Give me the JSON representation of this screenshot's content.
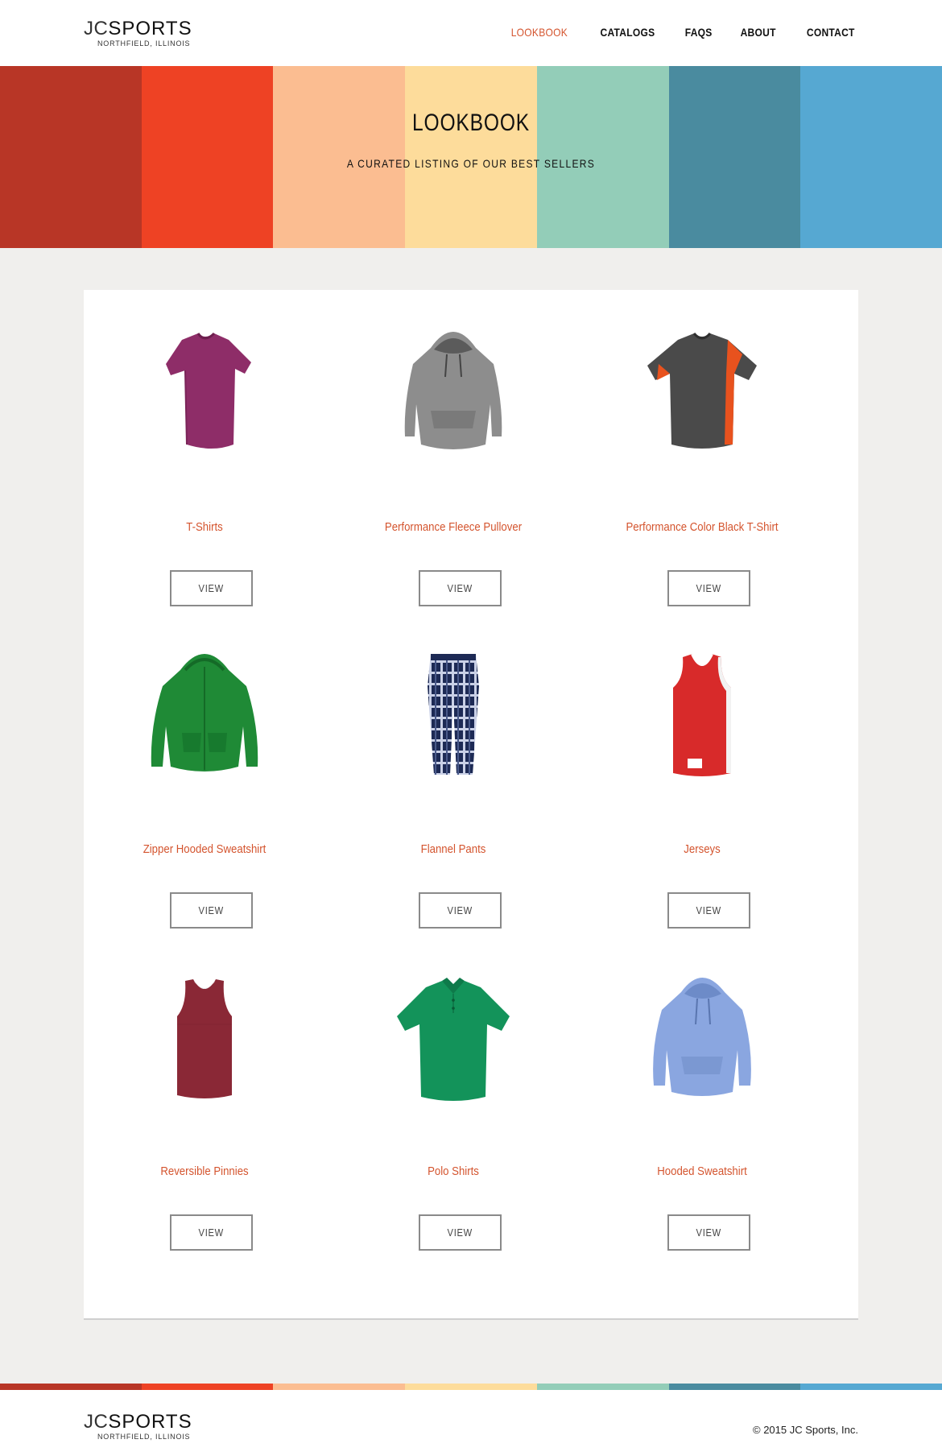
{
  "brand": {
    "name_jc": "JC",
    "name_sports": "SPORTS",
    "tagline": "NORTHFIELD, ILLINOIS",
    "accent": "#d4542e"
  },
  "nav": {
    "items": [
      "LOOKBOOK",
      "CATALOGS",
      "FAQS",
      "ABOUT",
      "CONTACT"
    ],
    "active": "LOOKBOOK"
  },
  "hero": {
    "title": "LOOKBOOK",
    "subtitle": "A CURATED LISTING OF OUR BEST SELLERS",
    "stripe_colors": [
      "#b83626",
      "#ee4224",
      "#fbbd91",
      "#fddc9b",
      "#93cdb8",
      "#4a8b9f",
      "#56a8d2"
    ]
  },
  "products": [
    {
      "name": "T-Shirts",
      "button": "VIEW",
      "icon": "tshirt-magenta-icon"
    },
    {
      "name": "Performance Fleece Pullover",
      "button": "VIEW",
      "icon": "grey-hoodie-icon"
    },
    {
      "name": "Performance Color Black T-Shirt",
      "button": "VIEW",
      "icon": "performance-tee-icon"
    },
    {
      "name": "Zipper Hooded Sweatshirt",
      "button": "VIEW",
      "icon": "green-zip-hoodie-icon"
    },
    {
      "name": "Flannel Pants",
      "button": "VIEW",
      "icon": "flannel-pants-icon"
    },
    {
      "name": "Jerseys",
      "button": "VIEW",
      "icon": "red-jersey-icon"
    },
    {
      "name": "Reversible Pinnies",
      "button": "VIEW",
      "icon": "maroon-pinnie-icon"
    },
    {
      "name": "Polo Shirts",
      "button": "VIEW",
      "icon": "green-polo-icon"
    },
    {
      "name": "Hooded Sweatshirt",
      "button": "VIEW",
      "icon": "blue-hoodie-icon"
    }
  ],
  "footer": {
    "copyright": "© 2015  JC Sports, Inc."
  }
}
